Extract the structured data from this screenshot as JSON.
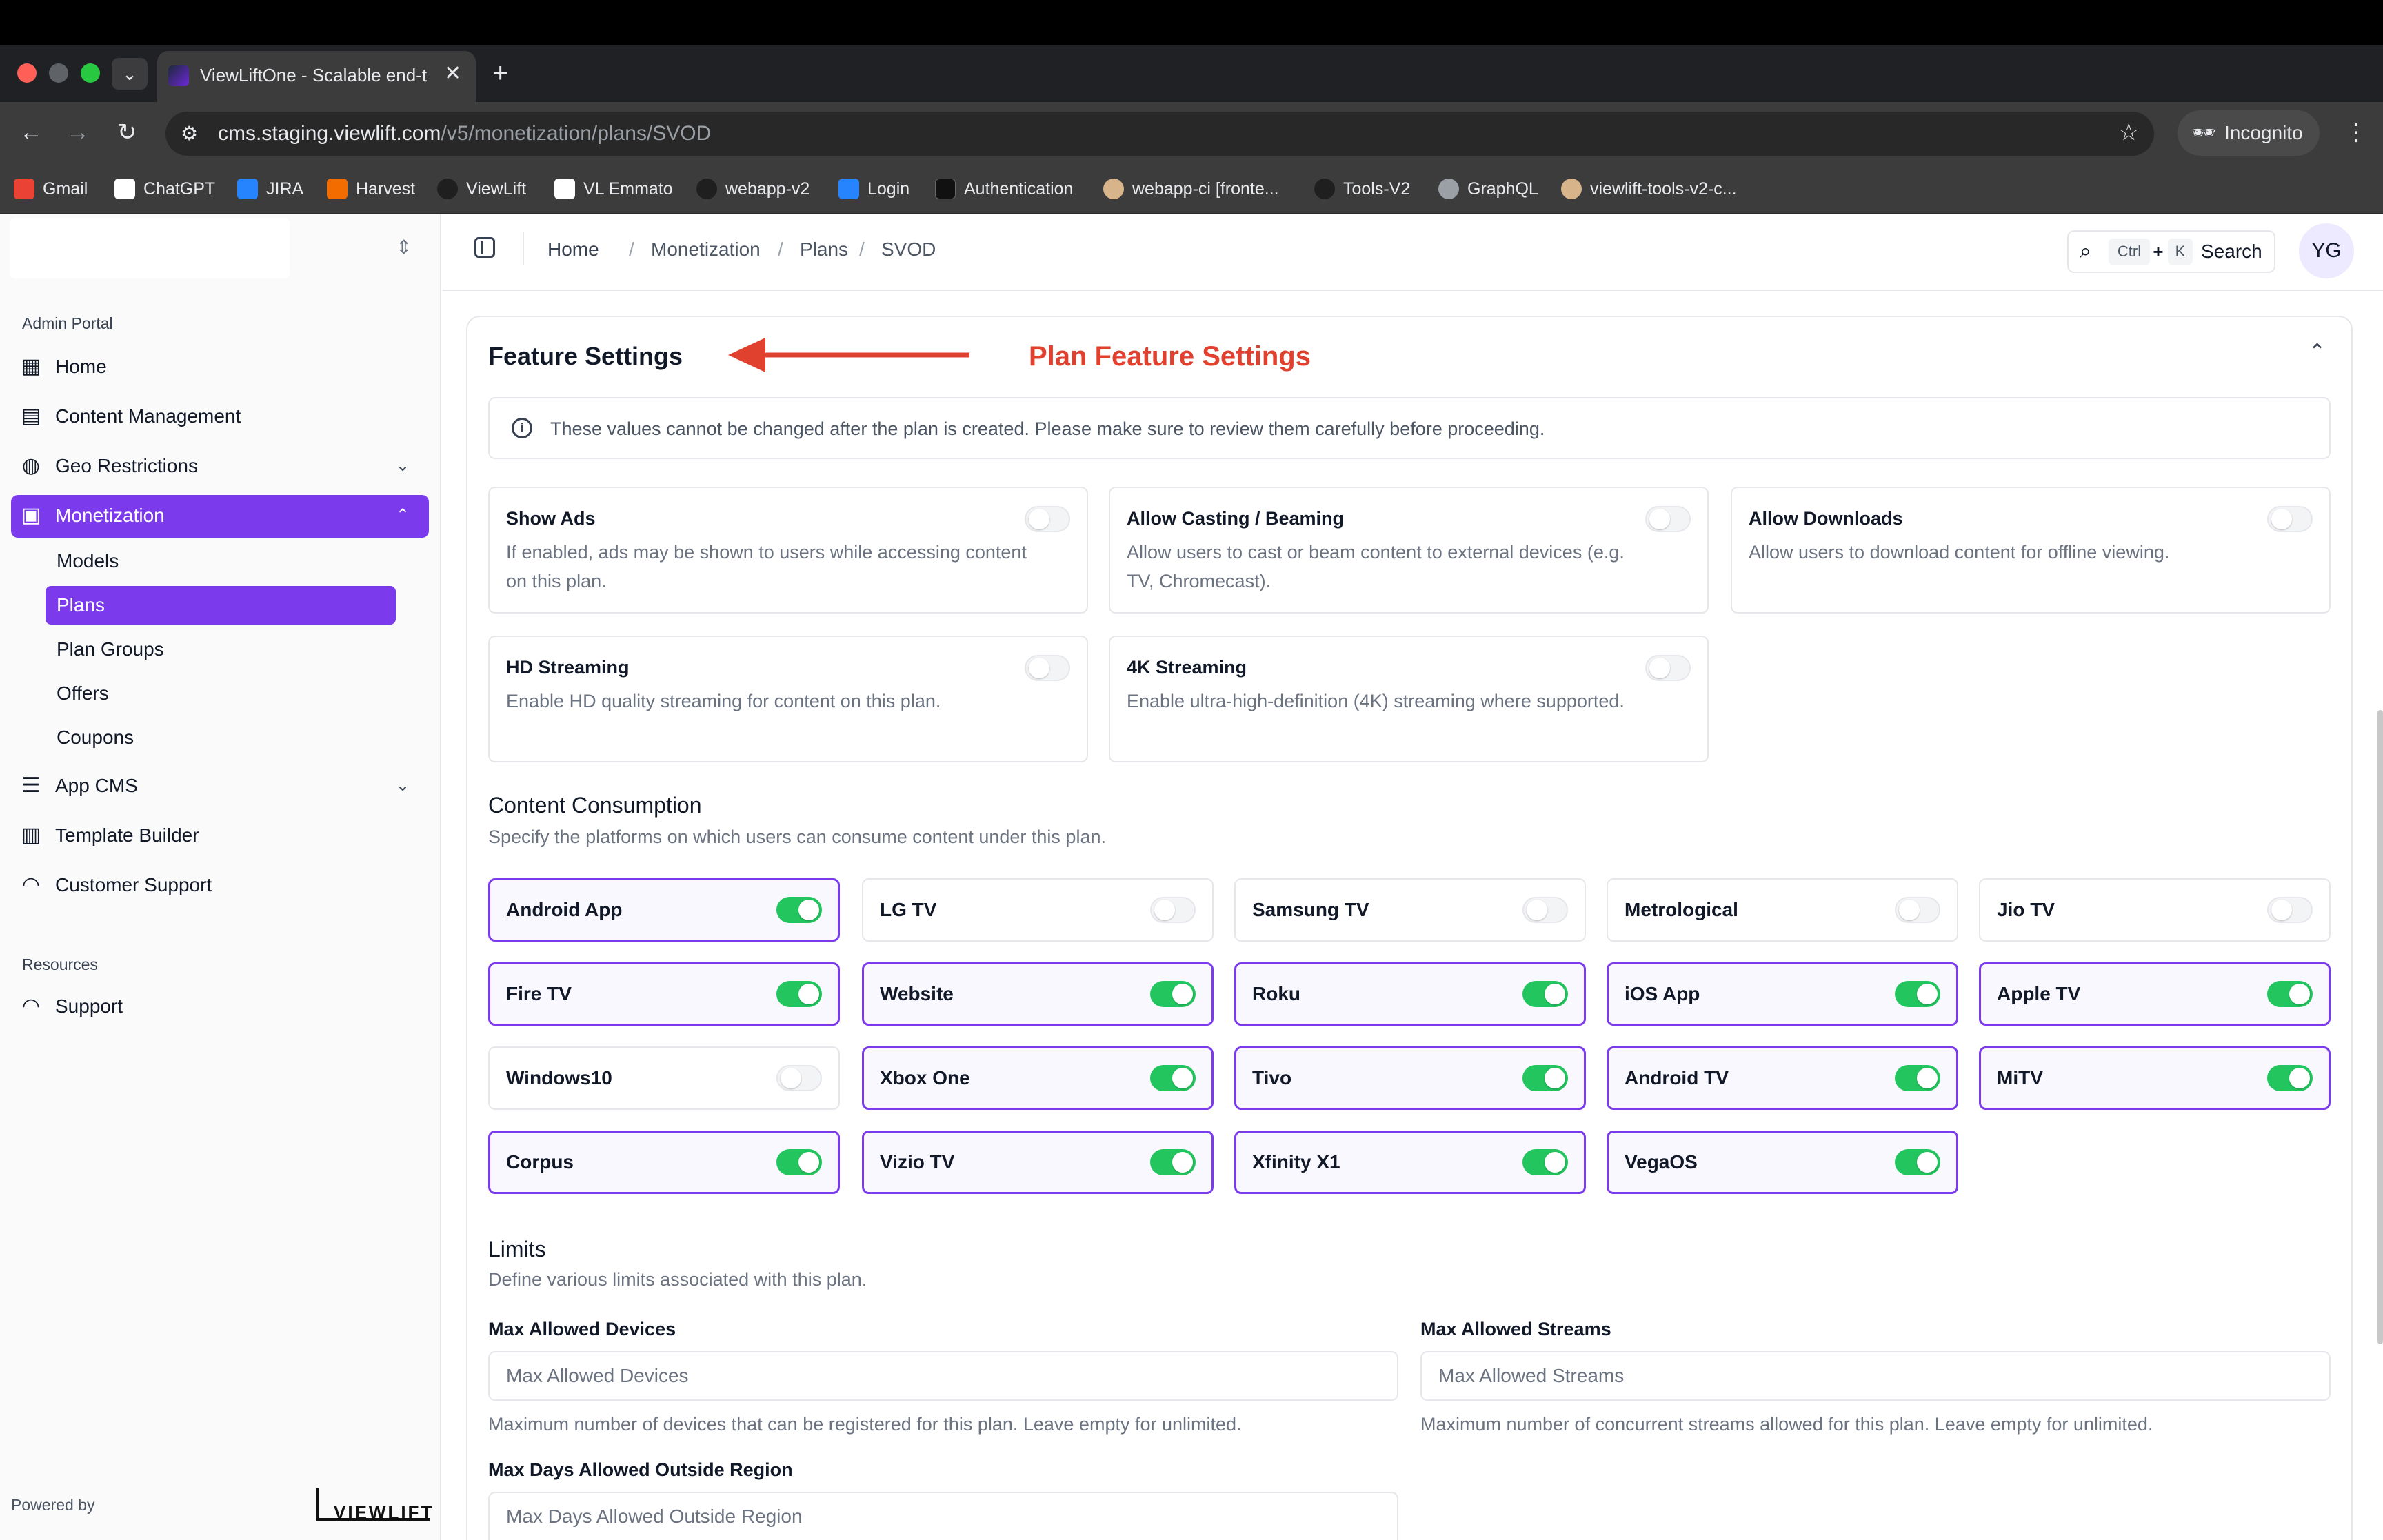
{
  "browser": {
    "tab_title": "ViewLiftOne - Scalable end-to",
    "url_host": "cms.staging.viewlift.com",
    "url_path": "/v5/monetization/plans/SVOD",
    "incognito_label": "Incognito",
    "bookmarks": [
      {
        "label": "Gmail",
        "icon": "gmail-icon",
        "color": "#ea4335"
      },
      {
        "label": "ChatGPT",
        "icon": "chatgpt-icon",
        "color": "#ffffff"
      },
      {
        "label": "JIRA",
        "icon": "jira-icon",
        "color": "#2684ff"
      },
      {
        "label": "Harvest",
        "icon": "harvest-icon",
        "color": "#f36c00"
      },
      {
        "label": "ViewLift",
        "icon": "github-icon",
        "color": "#1f1f1f"
      },
      {
        "label": "VL Emmato",
        "icon": "doc-icon",
        "color": "#ffffff"
      },
      {
        "label": "webapp-v2",
        "icon": "github-icon",
        "color": "#1f1f1f"
      },
      {
        "label": "Login",
        "icon": "jira-icon",
        "color": "#2684ff"
      },
      {
        "label": "Authentication",
        "icon": "auth-icon",
        "color": "#111111"
      },
      {
        "label": "webapp-ci [fronte...",
        "icon": "jenkins-icon",
        "color": "#d8b48a"
      },
      {
        "label": "Tools-V2",
        "icon": "github-icon",
        "color": "#1f1f1f"
      },
      {
        "label": "GraphQL",
        "icon": "globe-icon",
        "color": "#9aa0a6"
      },
      {
        "label": "viewlift-tools-v2-c...",
        "icon": "jenkins-icon",
        "color": "#d8b48a"
      }
    ]
  },
  "sidebar": {
    "group_admin": "Admin Portal",
    "items": [
      {
        "label": "Home",
        "icon": "dashboard-icon"
      },
      {
        "label": "Content Management",
        "icon": "film-icon"
      },
      {
        "label": "Geo Restrictions",
        "icon": "globe-icon"
      },
      {
        "label": "Monetization",
        "icon": "wallet-icon"
      },
      {
        "label": "App CMS",
        "icon": "sliders-icon"
      },
      {
        "label": "Template Builder",
        "icon": "layout-icon"
      },
      {
        "label": "Customer Support",
        "icon": "headset-icon"
      }
    ],
    "monetization_sub": [
      "Models",
      "Plans",
      "Plan Groups",
      "Offers",
      "Coupons"
    ],
    "group_resources": "Resources",
    "support_label": "Support",
    "powered_by": "Powered by",
    "brand_logo_text": "VIEWLIFT"
  },
  "header": {
    "breadcrumb": [
      "Home",
      "Monetization",
      "Plans",
      "SVOD"
    ],
    "search_kbd_ctrl": "Ctrl",
    "search_kbd_plus": "+",
    "search_kbd_k": "K",
    "search_label": "Search",
    "avatar_initials": "YG"
  },
  "feature_settings": {
    "title": "Feature Settings",
    "annotation": "Plan Feature Settings",
    "annotation_color": "#e0412f",
    "alert": "These values cannot be changed after the plan is created. Please make sure to review them carefully before proceeding.",
    "features": [
      {
        "title": "Show Ads",
        "desc": "If enabled, ads may be shown to users while accessing content on this plan.",
        "enabled": false
      },
      {
        "title": "Allow Casting / Beaming",
        "desc": "Allow users to cast or beam content to external devices (e.g. TV, Chromecast).",
        "enabled": false
      },
      {
        "title": "Allow Downloads",
        "desc": "Allow users to download content for offline viewing.",
        "enabled": false
      },
      {
        "title": "HD Streaming",
        "desc": "Enable HD quality streaming for content on this plan.",
        "enabled": false
      },
      {
        "title": "4K Streaming",
        "desc": "Enable ultra-high-definition (4K) streaming where supported.",
        "enabled": false
      }
    ]
  },
  "content_consumption": {
    "title": "Content Consumption",
    "subtitle": "Specify the platforms on which users can consume content under this plan.",
    "platforms": [
      {
        "label": "Android App",
        "enabled": true
      },
      {
        "label": "LG TV",
        "enabled": false
      },
      {
        "label": "Samsung TV",
        "enabled": false
      },
      {
        "label": "Metrological",
        "enabled": false
      },
      {
        "label": "Jio TV",
        "enabled": false
      },
      {
        "label": "Fire TV",
        "enabled": true
      },
      {
        "label": "Website",
        "enabled": true
      },
      {
        "label": "Roku",
        "enabled": true
      },
      {
        "label": "iOS App",
        "enabled": true
      },
      {
        "label": "Apple TV",
        "enabled": true
      },
      {
        "label": "Windows10",
        "enabled": false
      },
      {
        "label": "Xbox One",
        "enabled": true
      },
      {
        "label": "Tivo",
        "enabled": true
      },
      {
        "label": "Android TV",
        "enabled": true
      },
      {
        "label": "MiTV",
        "enabled": true
      },
      {
        "label": "Corpus",
        "enabled": true
      },
      {
        "label": "Vizio TV",
        "enabled": true
      },
      {
        "label": "Xfinity X1",
        "enabled": true
      },
      {
        "label": "VegaOS",
        "enabled": true
      }
    ]
  },
  "limits": {
    "title": "Limits",
    "subtitle": "Define various limits associated with this plan.",
    "max_devices": {
      "label": "Max Allowed Devices",
      "placeholder": "Max Allowed Devices",
      "value": "",
      "help": "Maximum number of devices that can be registered for this plan. Leave empty for unlimited."
    },
    "max_streams": {
      "label": "Max Allowed Streams",
      "placeholder": "Max Allowed Streams",
      "value": "",
      "help": "Maximum number of concurrent streams allowed for this plan. Leave empty for unlimited."
    },
    "max_days": {
      "label": "Max Days Allowed Outside Region",
      "placeholder": "Max Days Allowed Outside Region",
      "value": ""
    }
  },
  "colors": {
    "accent": "#7c3aed",
    "toggle_on": "#22c55e"
  }
}
